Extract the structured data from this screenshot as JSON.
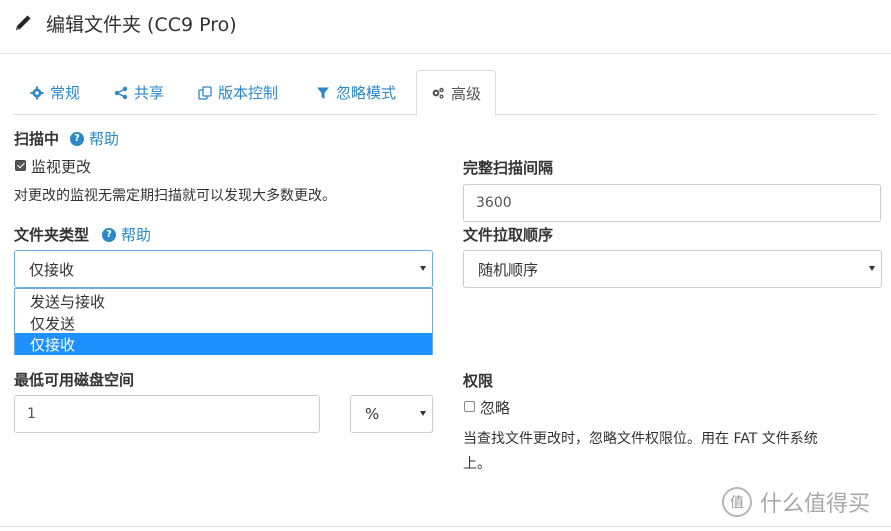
{
  "header": {
    "title": "编辑文件夹 (CC9 Pro)"
  },
  "tabs": [
    {
      "label": "常规",
      "icon": "gear-icon"
    },
    {
      "label": "共享",
      "icon": "share-icon"
    },
    {
      "label": "版本控制",
      "icon": "copy-icon"
    },
    {
      "label": "忽略模式",
      "icon": "filter-icon"
    },
    {
      "label": "高级",
      "icon": "gears-icon"
    }
  ],
  "active_tab": "高级",
  "scanning": {
    "label": "扫描中",
    "help": "帮助",
    "watch_label": "监视更改",
    "watch_checked": true,
    "watch_desc": "对更改的监视无需定期扫描就可以发现大多数更改。"
  },
  "full_scan": {
    "label": "完整扫描间隔",
    "value": "3600"
  },
  "folder_type": {
    "label": "文件夹类型",
    "help": "帮助",
    "selected": "仅接收",
    "options": [
      "发送与接收",
      "仅发送",
      "仅接收"
    ]
  },
  "pull_order": {
    "label": "文件拉取顺序",
    "selected": "随机顺序"
  },
  "min_disk": {
    "label": "最低可用磁盘空间",
    "value": "1",
    "unit": "%"
  },
  "permissions": {
    "label": "权限",
    "ignore_label": "忽略",
    "ignore_checked": false,
    "desc_line1": "当查找文件更改时，忽略文件权限位。用在 FAT 文件系统",
    "desc_line2": "上。"
  },
  "watermark": {
    "text": "什么值得买",
    "badge": "值"
  },
  "colors": {
    "link": "#2a87c9",
    "selected_option": "#1e90ff",
    "border": "#cccccc"
  }
}
